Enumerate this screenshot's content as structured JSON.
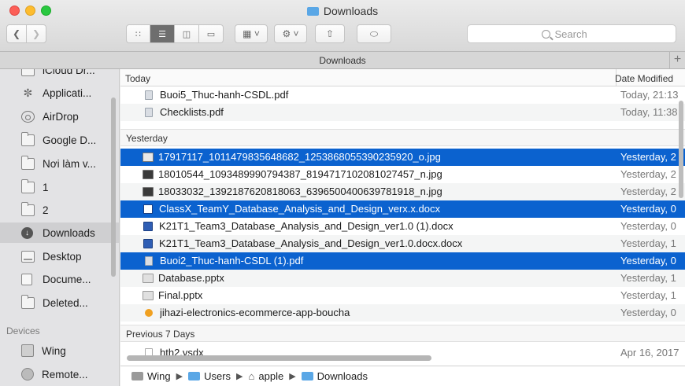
{
  "window": {
    "title": "Downloads",
    "path_tab": "Downloads",
    "search_placeholder": "Search"
  },
  "sidebar": {
    "items": [
      {
        "label": "iCloud Dr...",
        "icon": "cloud-icon"
      },
      {
        "label": "Applicati...",
        "icon": "applications-icon"
      },
      {
        "label": "AirDrop",
        "icon": "airdrop-icon"
      },
      {
        "label": "Google D...",
        "icon": "folder-icon"
      },
      {
        "label": "Nơi làm v...",
        "icon": "folder-icon"
      },
      {
        "label": "1",
        "icon": "folder-icon"
      },
      {
        "label": "2",
        "icon": "folder-icon"
      },
      {
        "label": "Downloads",
        "icon": "download-icon"
      },
      {
        "label": "Desktop",
        "icon": "desktop-icon"
      },
      {
        "label": "Docume...",
        "icon": "document-icon"
      },
      {
        "label": "Deleted...",
        "icon": "folder-icon"
      }
    ],
    "devices_header": "Devices",
    "devices": [
      {
        "label": "Wing",
        "icon": "hard-drive-icon"
      },
      {
        "label": "Remote...",
        "icon": "disc-icon"
      }
    ]
  },
  "list": {
    "columns": {
      "name": "Today",
      "date": "Date Modified"
    },
    "groups": {
      "today_rows": [
        {
          "name": "Buoi5_Thuc-hanh-CSDL.pdf",
          "date": "Today, 21:13",
          "type": "pdf"
        },
        {
          "name": "Checklists.pdf",
          "date": "Today, 11:38",
          "type": "pdf"
        }
      ],
      "yesterday_header": "Yesterday",
      "yesterday_rows": [
        {
          "name": "17917117_1011479835648682_1253868055390235920_o.jpg",
          "date": "Yesterday, 2",
          "type": "jpg",
          "selected": true
        },
        {
          "name": "18010544_1093489990794387_8194717102081027457_n.jpg",
          "date": "Yesterday, 2",
          "type": "jpg",
          "selected": false
        },
        {
          "name": "18033032_1392187620818063_6396500400639781918_n.jpg",
          "date": "Yesterday, 2",
          "type": "jpg",
          "selected": false
        },
        {
          "name": "ClassX_TeamY_Database_Analysis_and_Design_verx.x.docx",
          "date": "Yesterday, 0",
          "type": "docx",
          "selected": true
        },
        {
          "name": "K21T1_Team3_Database_Analysis_and_Design_ver1.0 (1).docx",
          "date": "Yesterday, 0",
          "type": "docx",
          "selected": false
        },
        {
          "name": "K21T1_Team3_Database_Analysis_and_Design_ver1.0.docx.docx",
          "date": "Yesterday, 1",
          "type": "docx",
          "selected": false
        },
        {
          "name": "Buoi2_Thuc-hanh-CSDL (1).pdf",
          "date": "Yesterday, 0",
          "type": "pdf",
          "selected": true
        },
        {
          "name": "Database.pptx",
          "date": "Yesterday, 1",
          "type": "pptx",
          "selected": false
        },
        {
          "name": "Final.pptx",
          "date": "Yesterday, 1",
          "type": "pptx",
          "selected": false
        },
        {
          "name": "jihazi-electronics-ecommerce-app-boucha",
          "date": "Yesterday, 0",
          "type": "html",
          "selected": false
        }
      ],
      "previous_header": "Previous 7 Days",
      "previous_rows": [
        {
          "name": "hth2.vsdx",
          "date": "Apr 16, 2017",
          "type": "file"
        }
      ]
    }
  },
  "pathbar": {
    "segments": [
      "Wing",
      "Users",
      "apple",
      "Downloads"
    ]
  },
  "colors": {
    "selection": "#0b62cf",
    "folder_blue": "#5aa7e6"
  }
}
